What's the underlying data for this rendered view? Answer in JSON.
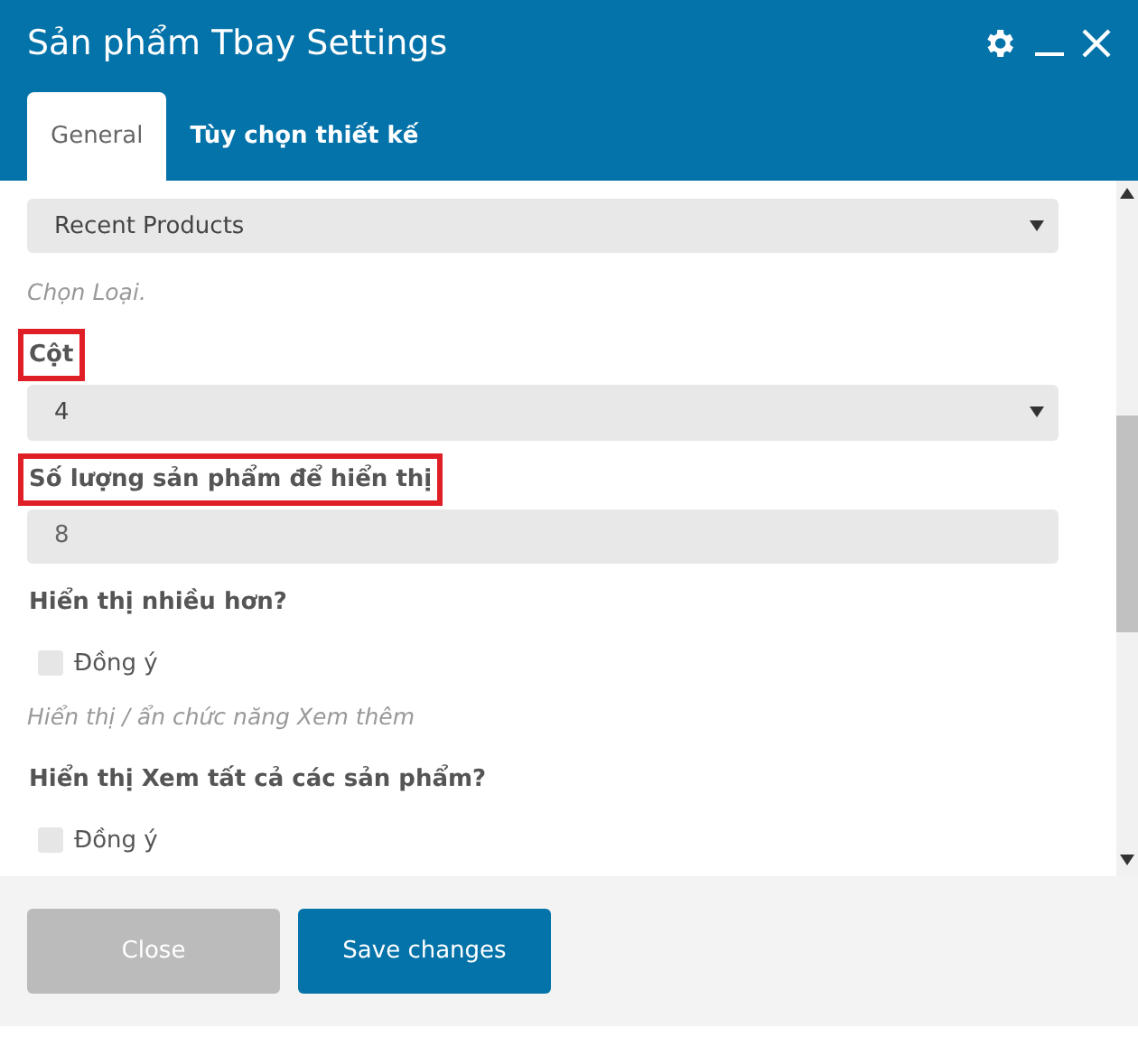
{
  "window": {
    "title": "Sản phẩm Tbay Settings"
  },
  "tabs": [
    {
      "label": "General",
      "selected": true
    },
    {
      "label": "Tùy chọn thiết kế",
      "selected": false
    }
  ],
  "fields": [
    {
      "kind": "select",
      "value": "Recent Products",
      "hint": "Chọn Loại."
    },
    {
      "kind": "select",
      "label": "Cột",
      "highlighted": true,
      "value": "4"
    },
    {
      "kind": "input",
      "label": "Số lượng sản phẩm để hiển thị",
      "highlighted": true,
      "value": "8"
    },
    {
      "kind": "checkbox",
      "label": "Hiển thị nhiều hơn?",
      "highlighted": false,
      "option": "Đồng ý",
      "checked": false,
      "hint": "Hiển thị / ẩn chức năng Xem thêm"
    },
    {
      "kind": "checkbox",
      "label": "Hiển thị Xem tất cả các sản phẩm?",
      "highlighted": false,
      "option": "Đồng ý",
      "checked": false
    }
  ],
  "buttons": [
    {
      "label": "Close",
      "kind": "secondary"
    },
    {
      "label": "Save changes",
      "kind": "primary"
    }
  ]
}
